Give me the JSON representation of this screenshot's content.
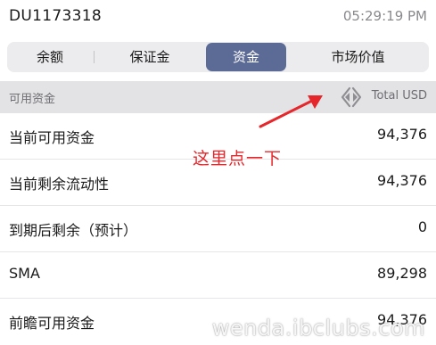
{
  "header": {
    "account_id": "DU1173318",
    "time": "05:29:19 PM"
  },
  "tabs": [
    {
      "label": "余额",
      "active": false
    },
    {
      "label": "保证金",
      "active": false
    },
    {
      "label": "资金",
      "active": true
    },
    {
      "label": "市场价值",
      "active": false
    }
  ],
  "section": {
    "title": "可用资金",
    "currency_label": "Total USD",
    "swap_icon": "left-right-toggle-icon"
  },
  "rows": [
    {
      "label": "当前可用资金",
      "value": "94,376"
    },
    {
      "label": "当前剩余流动性",
      "value": "94,376"
    },
    {
      "label": "到期后剩余（预计）",
      "value": "0"
    },
    {
      "label": "SMA",
      "value": "89,298"
    },
    {
      "label": "前瞻可用资金",
      "value": "94,376"
    }
  ],
  "annotation": {
    "text": "这里点一下",
    "color": "#e5262b"
  },
  "watermark": "wenda.ibclubs.com",
  "colors": {
    "active_tab": "#5c6b96",
    "section_bg": "#e3e3e5",
    "annotation": "#e5262b"
  }
}
